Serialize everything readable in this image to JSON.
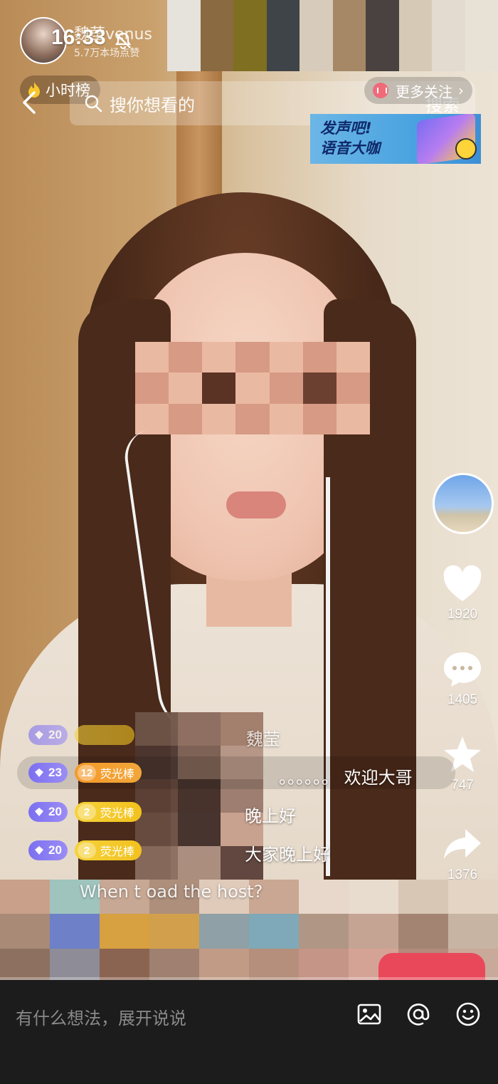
{
  "status_bar": {
    "time": "16:33"
  },
  "host": {
    "name": "魏莹venus",
    "likes": "5.7万本场点赞"
  },
  "hour_rank": {
    "label": "小时榜"
  },
  "search": {
    "placeholder": "搜你想看的",
    "button": "搜索"
  },
  "more_follow": {
    "label": "更多关注"
  },
  "banner": {
    "line1": "发声吧!",
    "line2": "语音大咖"
  },
  "right_rail": {
    "likes": "1920",
    "comments": "1405",
    "favorites": "747",
    "shares": "1376"
  },
  "chat": [
    {
      "level": "20",
      "fan_num": "",
      "fan_label": "",
      "user": "魏莹",
      "text": ""
    },
    {
      "level": "23",
      "fan_num": "12",
      "fan_label": "荧光棒",
      "text": "。。。。。。 欢迎大哥"
    },
    {
      "level": "20",
      "fan_num": "2",
      "fan_label": "荧光棒",
      "text": "晚上好"
    },
    {
      "level": "20",
      "fan_num": "2",
      "fan_label": "荧光棒",
      "text": "大家晚上好"
    }
  ],
  "chat_partial": {
    "text": "When t       oad the host?"
  },
  "comment_bar": {
    "placeholder": "有什么想法，展开说说"
  },
  "colors": {
    "accent_red": "#e8485a",
    "badge_purple": "#8a7df2",
    "badge_yellow": "#f4cb2c",
    "badge_orange": "#f49a2a"
  }
}
